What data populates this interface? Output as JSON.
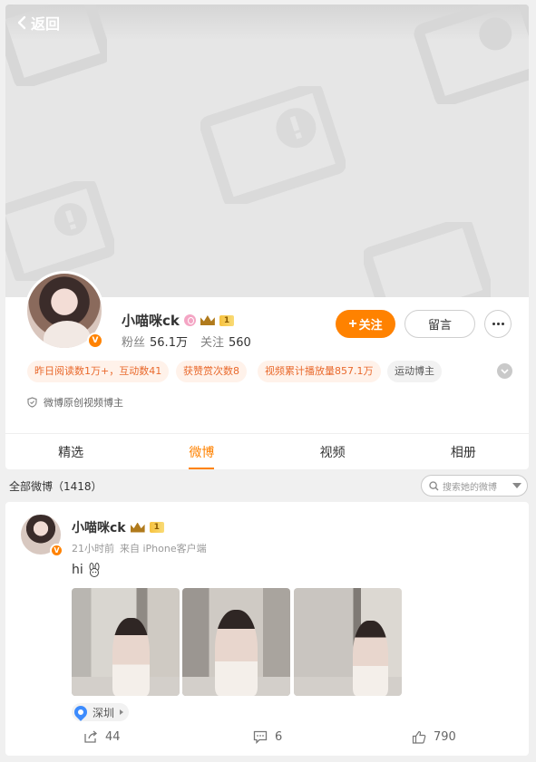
{
  "nav": {
    "back_label": "返回"
  },
  "profile": {
    "name": "小喵咪ck",
    "level": "1",
    "verified_mark": "V",
    "fans_label": "粉丝",
    "fans_value": "56.1万",
    "following_label": "关注",
    "following_value": "560",
    "follow_label": "关注",
    "message_label": "留言",
    "tags": [
      "昨日阅读数1万+，互动数41",
      "获赞赏次数8",
      "视频累计播放量857.1万",
      "运动博主"
    ],
    "certification": "微博原创视频博主"
  },
  "tabs": [
    {
      "label": "精选"
    },
    {
      "label": "微博"
    },
    {
      "label": "视频"
    },
    {
      "label": "相册"
    }
  ],
  "active_tab": "微博",
  "list": {
    "header": "全部微博（1418）",
    "search_placeholder": "搜索她的微博"
  },
  "post": {
    "author": "小喵咪ck",
    "level": "1",
    "time": "21小时前",
    "source": "来自 iPhone客户端",
    "text": "hi",
    "location": "深圳",
    "reposts": "44",
    "comments": "6",
    "likes": "790"
  },
  "colors": {
    "accent": "#ff8200",
    "tag_text": "#e9692c",
    "tag_bg": "#fff2ea",
    "location_pin": "#3d8bfd"
  },
  "icons": [
    "back-chevron-icon",
    "image-placeholder-icon",
    "crown-icon",
    "shield-icon",
    "search-icon",
    "location-pin-icon",
    "repost-icon",
    "comment-icon",
    "like-icon",
    "more-icon",
    "bunny-emoji-icon"
  ]
}
